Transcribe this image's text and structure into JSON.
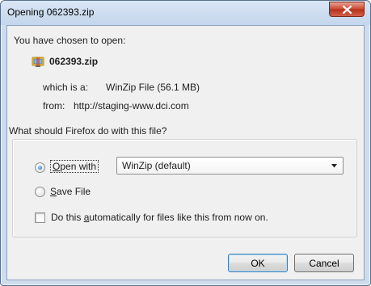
{
  "window": {
    "title": "Opening 062393.zip",
    "close_label": "close"
  },
  "dialog": {
    "prompt": "You have chosen to open:",
    "file_name": "062393.zip",
    "type_label": "which is a:",
    "type_value": "WinZip File (56.1 MB)",
    "from_label": "from:",
    "from_value": "http://staging-www.dci.com",
    "question": "What should Firefox do with this file?"
  },
  "options": {
    "open_with_underline": "O",
    "open_with_rest": "pen with",
    "open_with_selected": true,
    "open_with_app": "WinZip (default)",
    "save_underline": "S",
    "save_rest": "ave File",
    "save_selected": false,
    "auto_prefix": "Do this ",
    "auto_underline": "a",
    "auto_rest": "utomatically for files like this from now on.",
    "auto_checked": false
  },
  "buttons": {
    "ok_label": "OK",
    "cancel_label": "Cancel"
  },
  "icons": {
    "file": "winzip-file-icon",
    "close": "close-icon",
    "dropdown": "chevron-down-icon"
  },
  "colors": {
    "titlebar": "#c4d6ec",
    "close_button": "#c8452f",
    "client_bg": "#f0f0f0",
    "default_button_border": "#3c7fb1"
  }
}
